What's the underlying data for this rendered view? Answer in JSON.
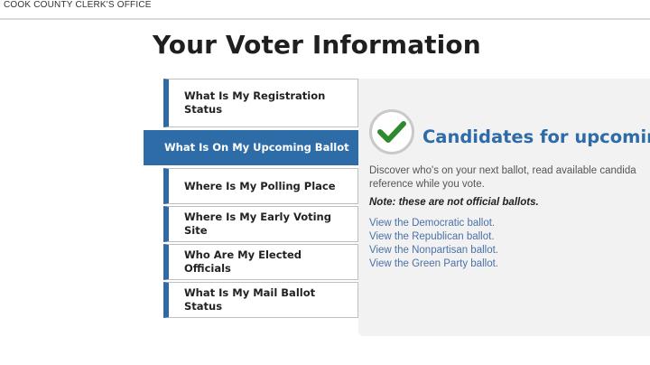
{
  "header": {
    "site_name": "COOK COUNTY CLERK'S OFFICE"
  },
  "page": {
    "title": "Your Voter Information"
  },
  "nav": {
    "items": [
      {
        "label_line1": "What Is My Registration",
        "label_line2": "Status",
        "active": false
      },
      {
        "label": "What Is On My Upcoming Ballot",
        "active": true
      },
      {
        "label": "Where Is My Polling Place",
        "active": false
      },
      {
        "label": "Where Is My Early Voting Site",
        "active": false
      },
      {
        "label": "Who Are My Elected Officials",
        "active": false
      },
      {
        "label": "What Is My Mail Ballot Status",
        "active": false
      }
    ]
  },
  "panel": {
    "icon": "checkmark-icon",
    "title": "Candidates for upcoming",
    "description_line1": "Discover who's on your next ballot, read available candida",
    "description_line2": "reference while you vote.",
    "note": "Note: these are not official ballots.",
    "links": [
      "View the Democratic ballot.",
      "View the Republican ballot.",
      "View the Nonpartisan ballot.",
      "View the Green Party ballot."
    ]
  },
  "colors": {
    "accent": "#2e6ca8",
    "check": "#2f8a2f",
    "link": "#4a72a8",
    "panel_bg": "#f2f2f2"
  }
}
